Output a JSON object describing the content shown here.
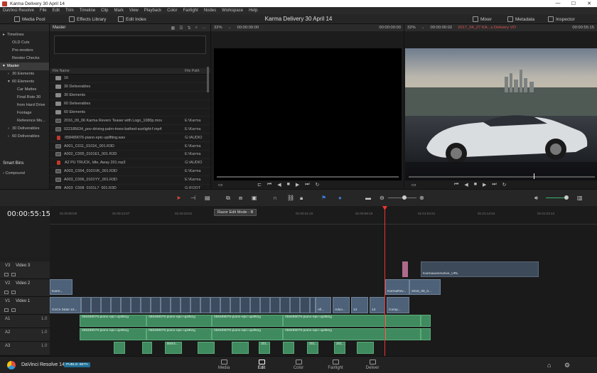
{
  "window": {
    "title": "Karma Delivery 30 April 14",
    "minimize": "—",
    "maximize": "☐",
    "close": "✕"
  },
  "menu": [
    "DaVinci Resolve",
    "File",
    "Edit",
    "Trim",
    "Timeline",
    "Clip",
    "Mark",
    "View",
    "Playback",
    "Color",
    "Fairlight",
    "Nodes",
    "Workspace",
    "Help"
  ],
  "header": {
    "media_pool": "Media Pool",
    "effects_library": "Effects Library",
    "edit_index": "Edit Index",
    "project_title": "Karma Delivery 30 April 14",
    "mixer": "Mixer",
    "metadata": "Metadata",
    "inspector": "Inspector"
  },
  "bins": {
    "header": "Master",
    "items": [
      {
        "label": "Timelines",
        "indent": 0,
        "expander": "▸"
      },
      {
        "label": "OLD Cuts",
        "indent": 1,
        "expander": ""
      },
      {
        "label": "Pre-renders",
        "indent": 1,
        "expander": ""
      },
      {
        "label": "Render Checks",
        "indent": 1,
        "expander": ""
      },
      {
        "label": "Master",
        "indent": 0,
        "expander": "▾",
        "selected": true
      },
      {
        "label": "30 Elements",
        "indent": 1,
        "expander": "›"
      },
      {
        "label": "60 Elements",
        "indent": 1,
        "expander": "▾"
      },
      {
        "label": "Car Mattes",
        "indent": 2,
        "expander": ""
      },
      {
        "label": "Final Roto 30",
        "indent": 2,
        "expander": ""
      },
      {
        "label": "from Hard Drive",
        "indent": 2,
        "expander": ""
      },
      {
        "label": "Footage",
        "indent": 2,
        "expander": ""
      },
      {
        "label": "Reference Mo...",
        "indent": 2,
        "expander": ""
      },
      {
        "label": "30 Deliverables",
        "indent": 1,
        "expander": "›"
      },
      {
        "label": "60 Deliverables",
        "indent": 1,
        "expander": "›"
      }
    ],
    "smart_bins": "Smart Bins",
    "compound": "Compound"
  },
  "media_pool": {
    "bin_name": "Master",
    "columns": {
      "name": "File Name",
      "path": "File Path"
    },
    "rows": [
      {
        "name": "16",
        "path": "",
        "kind": "folder"
      },
      {
        "name": "30 Deliverables",
        "path": "",
        "kind": "folder"
      },
      {
        "name": "30 Elements",
        "path": "",
        "kind": "folder"
      },
      {
        "name": "60 Deliverables",
        "path": "",
        "kind": "folder"
      },
      {
        "name": "60 Elements",
        "path": "",
        "kind": "folder"
      },
      {
        "name": "2016_09_06 Karma Revero Teaser with Logo_1080p.mov",
        "path": "E:\\Karma",
        "kind": "video"
      },
      {
        "name": "022185634_pov-driving-palm-trees-bathed-sunlight-f.mp4",
        "path": "E:\\Karma",
        "kind": "video"
      },
      {
        "name": "058489076-piano-epic-uplifting.wav",
        "path": "G:\\AUDIO",
        "kind": "audio"
      },
      {
        "name": "A001_C011_0101K_001.R3D",
        "path": "E:\\Karma",
        "kind": "video"
      },
      {
        "name": "A002_C005_0101E1_001.R3D",
        "path": "E:\\Karma",
        "kind": "video"
      },
      {
        "name": "A2 PU TRUCK, Idle, Away 201.mp3",
        "path": "G:\\AUDIO",
        "kind": "audio"
      },
      {
        "name": "A003_C004_0101VK_001.R3D",
        "path": "E:\\Karma",
        "kind": "video"
      },
      {
        "name": "A003_C006_0101YY_001.R3D",
        "path": "E:\\Karma",
        "kind": "video"
      },
      {
        "name": "A003_C008_0101L7_001.R3D",
        "path": "G:\\FOOT",
        "kind": "video"
      }
    ]
  },
  "source_viewer": {
    "zoom": "32%",
    "timecode_in": "00:00:00:00",
    "timecode_out": "00:00:00:00"
  },
  "timeline_viewer": {
    "zoom": "32%",
    "timecode_in": "00:00:00:02",
    "timeline_name": "2017_04_27 KA...s Delivery VO",
    "timecode": "00:00:55:15"
  },
  "timeline": {
    "timecode": "00:00:55:15",
    "ruler": [
      "01:00:00:00",
      "01:00:12:07",
      "01:00:23:01",
      "01:00:34:03",
      "01:00:41:10",
      "01:00:48:15",
      "01:00:59:19",
      "01:01:04:21",
      "01:01:12:04",
      "01:01:22:12"
    ],
    "tooltip": "Razor Edit Mode - B",
    "tracks": [
      {
        "id": "V3",
        "name": "Video 3"
      },
      {
        "id": "V2",
        "name": "Video 2"
      },
      {
        "id": "V1",
        "name": "Video 1"
      },
      {
        "id": "A1",
        "name": "",
        "level": "1.0"
      },
      {
        "id": "A2",
        "name": "",
        "level": "1.0"
      },
      {
        "id": "A3",
        "name": "",
        "level": "1.0"
      }
    ],
    "clip_labels": {
      "karma": "Karm...",
      "karma_automotive": "Karmaautomotive_URL",
      "karma_rev": "KarmaRev...",
      "date_clip": "2016_09_0...",
      "gocs": "GoCs State 10...",
      "all": "All...",
      "advo": "Advo...",
      "c13": "13",
      "c13b": "13",
      "comp": "Comp...",
      "audio_main": "058489076-piano-epic-uplifting",
      "a3_short": "201...",
      "a3_b": "B9X4..."
    }
  },
  "pages": {
    "brand": "DaVinci Resolve 14",
    "beta": "PUBLIC BETA",
    "tabs": [
      "Media",
      "Edit",
      "Color",
      "Fairlight",
      "Deliver"
    ],
    "active": "Edit"
  },
  "colors": {
    "accent_red": "#e33333",
    "video_clip": "#4d6178",
    "audio_clip": "#3f8a5f",
    "beta": "#1f6f94"
  }
}
